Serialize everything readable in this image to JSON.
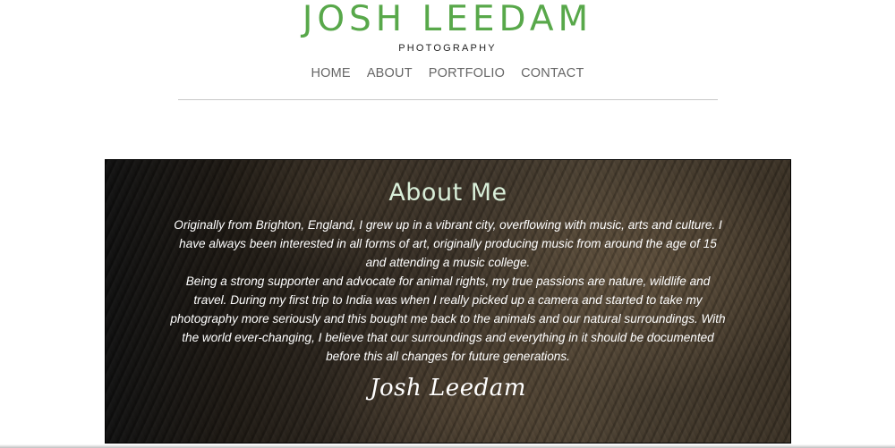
{
  "header": {
    "brand_name": "JOSH LEEDAM",
    "tagline": "PHOTOGRAPHY",
    "nav": [
      {
        "label": "HOME"
      },
      {
        "label": "ABOUT"
      },
      {
        "label": "PORTFOLIO"
      },
      {
        "label": "CONTACT"
      }
    ]
  },
  "about": {
    "title": "About Me",
    "paragraph": "Originally from Brighton, England, I grew up in a vibrant city, overflowing with music, arts and culture. I have always been interested in all forms of art, originally producing music from around the age of 15 and attending a music college.",
    "paragraph_2": "Being a strong supporter and advocate for animal rights, my true passions are nature, wildlife and travel. During my first trip to India was when I really picked up a camera and started to take my photography more seriously and this bought me back to the animals and our natural surroundings. With the world ever-changing, I believe that our surroundings and everything in it should be documented before this all changes for future generations.",
    "signature": "Josh Leedam"
  },
  "colors": {
    "brand_green": "#58a84a",
    "title_mint": "#d9efd9",
    "nav_gray": "#666666"
  }
}
